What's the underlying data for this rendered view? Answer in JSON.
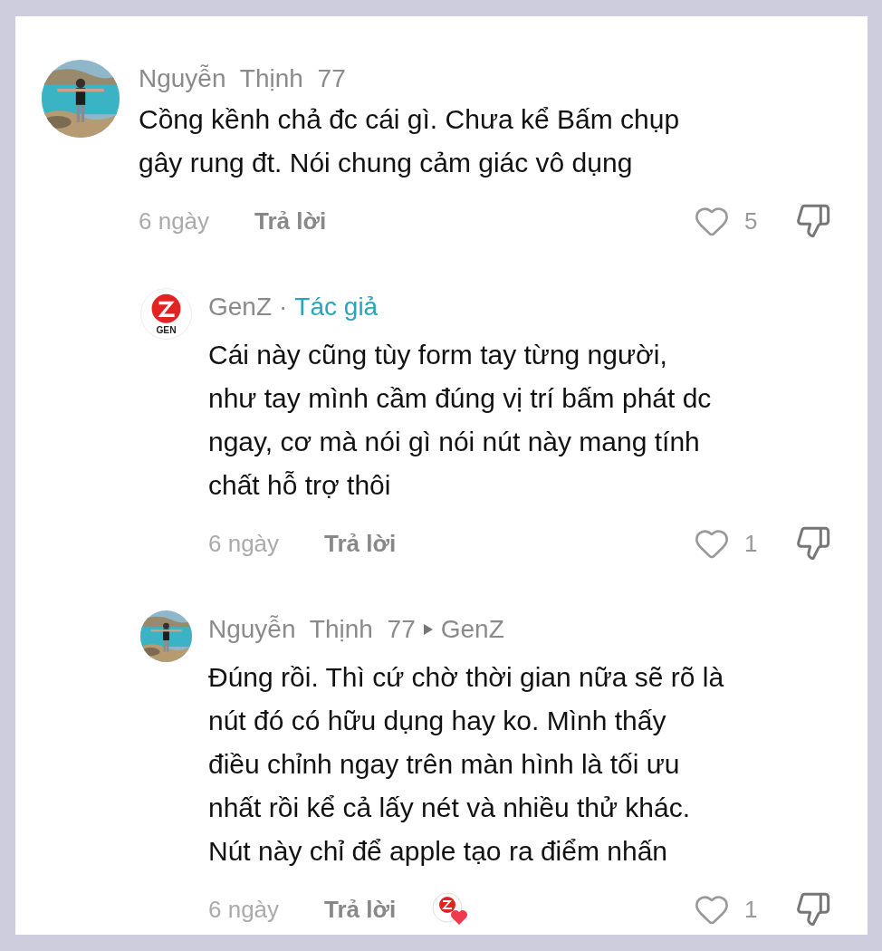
{
  "comments": [
    {
      "name": "Nguyễn Thịnh 77",
      "lines": [
        "Cồng kềnh chả đc cái gì. Chưa kể Bấm chụp",
        "gây rung đt. Nói chung cảm giác vô dụng"
      ],
      "time": "6 ngày",
      "reply": "Trả lời",
      "likes": "5",
      "liked": false,
      "liked_by_author": false,
      "children": [
        {
          "avatar": {
            "kind": "logo",
            "text": "GEN"
          },
          "name": "GenZ",
          "separator": "·",
          "badge": "Tác giả",
          "lines": [
            "Cái này cũng tùy form tay từng người,",
            "như tay mình cầm đúng vị trí bấm phát dc",
            "ngay, cơ mà nói gì nói nút này mang tính",
            "chất hỗ trợ thôi"
          ],
          "time": "6 ngày",
          "reply": "Trả lời",
          "likes": "1",
          "liked": false,
          "liked_by_author": false
        },
        {
          "name": "Nguyễn Thịnh 77",
          "reply_to": "GenZ",
          "lines": [
            "Đúng rồi. Thì cứ chờ thời gian nữa sẽ rõ là",
            "nút đó có hữu dụng hay ko. Mình thấy",
            "điều chỉnh ngay trên màn hình là tối ưu",
            "nhất rồi kể cả lấy nét và nhiều thử khác.",
            "Nút này chỉ để apple tạo ra điểm nhấn"
          ],
          "time": "6 ngày",
          "reply": "Trả lời",
          "likes": "1",
          "liked": false,
          "liked_by_author": true
        }
      ]
    }
  ]
}
